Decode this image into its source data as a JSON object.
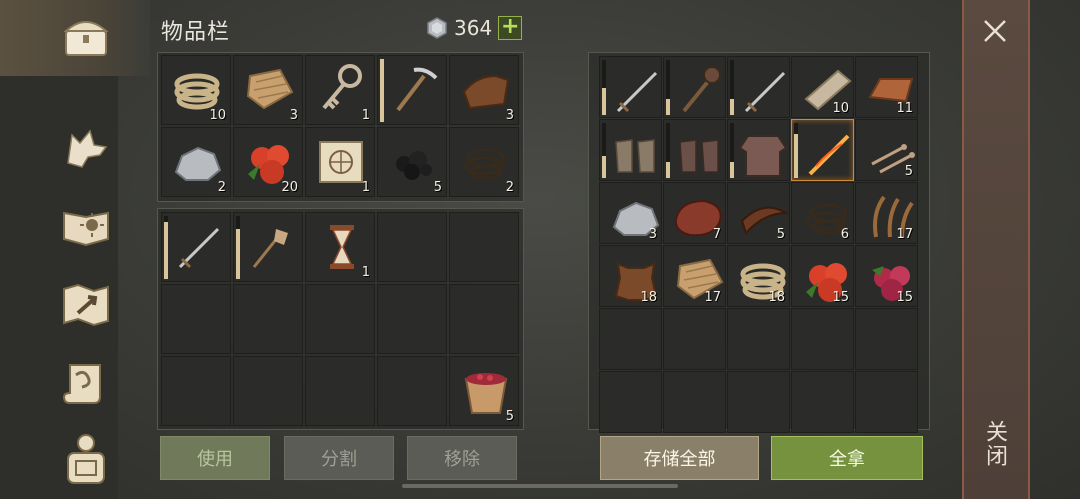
{
  "header": {
    "title": "物品栏",
    "currency_value": "364",
    "add_label": "+"
  },
  "sidebar": {
    "tabs": [
      {
        "name": "chest-icon",
        "active": true
      },
      {
        "name": "wolf-icon"
      },
      {
        "name": "sun-book-icon"
      },
      {
        "name": "map-icon"
      },
      {
        "name": "scroll-icon"
      },
      {
        "name": "backpack-icon"
      }
    ]
  },
  "inventory_top": [
    {
      "icon": "rope",
      "qty": "10"
    },
    {
      "icon": "cloth",
      "qty": "3"
    },
    {
      "icon": "key",
      "qty": "1"
    },
    {
      "icon": "pickaxe",
      "qty": "",
      "dur": 1.0
    },
    {
      "icon": "leather",
      "qty": "3"
    },
    {
      "icon": "stone",
      "qty": "2"
    },
    {
      "icon": "berries",
      "qty": "20"
    },
    {
      "icon": "recipe-scroll",
      "qty": "1"
    },
    {
      "icon": "coal",
      "qty": "5"
    },
    {
      "icon": "string",
      "qty": "2"
    }
  ],
  "inventory_bottom": [
    {
      "icon": "sword",
      "qty": "",
      "dur": 0.9
    },
    {
      "icon": "shovel",
      "qty": "",
      "dur": 0.8
    },
    {
      "icon": "hourglass",
      "qty": "1"
    },
    {
      "icon": "",
      "qty": ""
    },
    {
      "icon": "",
      "qty": ""
    },
    {
      "icon": "",
      "qty": ""
    },
    {
      "icon": "",
      "qty": ""
    },
    {
      "icon": "",
      "qty": ""
    },
    {
      "icon": "",
      "qty": ""
    },
    {
      "icon": "",
      "qty": ""
    },
    {
      "icon": "",
      "qty": ""
    },
    {
      "icon": "",
      "qty": ""
    },
    {
      "icon": "",
      "qty": ""
    },
    {
      "icon": "",
      "qty": ""
    },
    {
      "icon": "berry-bucket",
      "qty": "5"
    }
  ],
  "storage": [
    {
      "icon": "sword",
      "qty": "",
      "dur": 0.5
    },
    {
      "icon": "mace",
      "qty": "",
      "dur": 0.3
    },
    {
      "icon": "sword",
      "qty": "",
      "dur": 0.3
    },
    {
      "icon": "plank",
      "qty": "10"
    },
    {
      "icon": "ingot",
      "qty": "11"
    },
    {
      "icon": "gloves",
      "qty": "",
      "dur": 0.4
    },
    {
      "icon": "chain-gloves",
      "qty": "",
      "dur": 0.3
    },
    {
      "icon": "chainmail",
      "qty": "",
      "dur": 0.3
    },
    {
      "icon": "fire-sword",
      "qty": "",
      "dur": 0.8,
      "highlight": true
    },
    {
      "icon": "nails",
      "qty": "5"
    },
    {
      "icon": "stone",
      "qty": "3"
    },
    {
      "icon": "meat",
      "qty": "7"
    },
    {
      "icon": "leather-strip",
      "qty": "5"
    },
    {
      "icon": "string",
      "qty": "6"
    },
    {
      "icon": "plant-fiber",
      "qty": "17"
    },
    {
      "icon": "hide",
      "qty": "18"
    },
    {
      "icon": "cloth",
      "qty": "17"
    },
    {
      "icon": "rope",
      "qty": "18"
    },
    {
      "icon": "berries",
      "qty": "15"
    },
    {
      "icon": "dark-berries",
      "qty": "15"
    },
    {
      "icon": "",
      "qty": ""
    },
    {
      "icon": "",
      "qty": ""
    },
    {
      "icon": "",
      "qty": ""
    },
    {
      "icon": "",
      "qty": ""
    },
    {
      "icon": "",
      "qty": ""
    },
    {
      "icon": "",
      "qty": ""
    },
    {
      "icon": "",
      "qty": ""
    },
    {
      "icon": "",
      "qty": ""
    },
    {
      "icon": "",
      "qty": ""
    },
    {
      "icon": "",
      "qty": ""
    }
  ],
  "buttons": {
    "use": "使用",
    "split": "分割",
    "remove": "移除",
    "store_all": "存储全部",
    "take_all": "全拿"
  },
  "close": {
    "label": "关闭"
  }
}
